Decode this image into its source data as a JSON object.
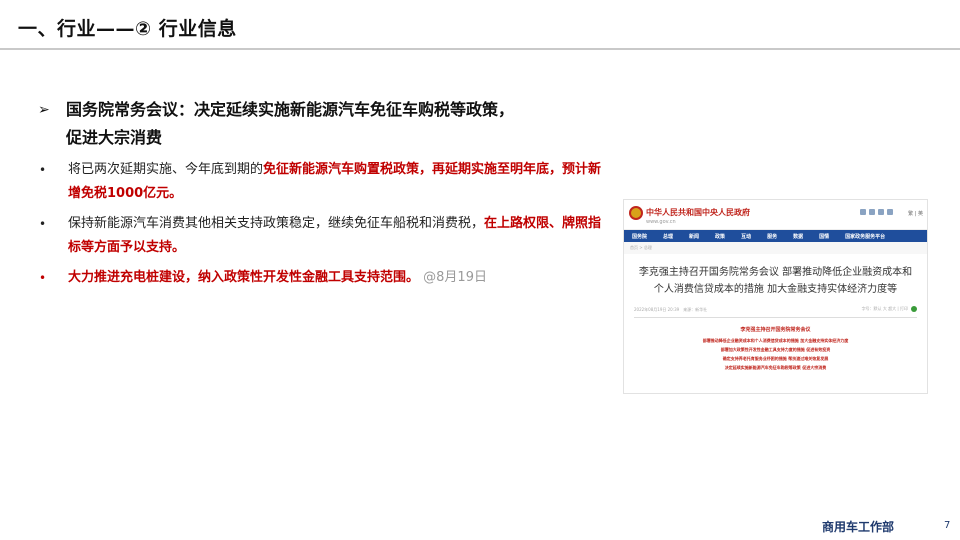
{
  "slide": {
    "title": "一、行业——② 行业信息",
    "heading_arrow": "➢",
    "heading_line1": "国务院常务会议：决定延续实施新能源汽车免征车购税等政策，",
    "heading_line2": "促进大宗消费",
    "bullet_symbol": "•",
    "bullets": [
      {
        "plain": "将已两次延期实施、今年底到期的",
        "red": "免征新能源汽车购置税政策，再延期实施至明年底，预计新增免税1000亿元。"
      },
      {
        "plain": "保持新能源汽车消费其他相关支持政策稳定，继续免征车船税和消费税，",
        "red": "在上路权限、牌照指标等方面予以支持。"
      },
      {
        "red": "大力推进充电桩建设，纳入政策性开发性金融工具支持范围。",
        "gray": "@8月19日"
      }
    ],
    "footer": "商用车工作部",
    "page_number": "7"
  },
  "screenshot": {
    "site_name": "中华人民共和国中央人民政府",
    "site_url": "www.gov.cn",
    "toolbar_text": "繁 | 英",
    "nav": [
      "国务院",
      "总理",
      "新闻",
      "政策",
      "互动",
      "服务",
      "数据",
      "国情",
      "国家政务服务平台"
    ],
    "breadcrumb": "首页 > 总理",
    "headline": "李克强主持召开国务院常务会议 部署推动降低企业融资成本和个人消费信贷成本的措施 加大金融支持实体经济力度等",
    "meta_left": "2022年08月19日 20:39　来源：新华社",
    "meta_right": "字号：默认 大 超大 | 打印",
    "sub_title": "李克强主持召开国务院常务会议",
    "sub_lines": [
      "部署推动降低企业融资成本和个人消费信贷成本的措施 加大金融支持实体经济力度",
      "部署加大政策性开发性金融工具支持力度的措施 促进有效投资",
      "确定支持养老托育服务业纾困的措施 帮扶渡过难关恢复发展",
      "决定延续实施新能源汽车免征车购税等政策 促进大宗消费"
    ]
  },
  "colors": {
    "accent_red": "#c00000",
    "nav_blue": "#1f4e9c",
    "footer_blue": "#1f3a6e",
    "gov_red": "#c0261e"
  }
}
